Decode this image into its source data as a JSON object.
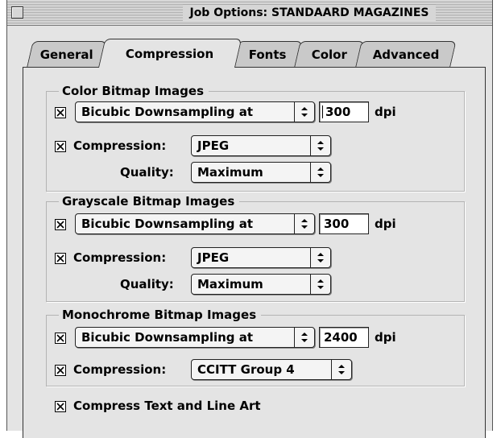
{
  "window": {
    "title": "Job Options: STANDAARD MAGAZINES"
  },
  "tabs": [
    {
      "label": "General",
      "active": false
    },
    {
      "label": "Compression",
      "active": true
    },
    {
      "label": "Fonts",
      "active": false
    },
    {
      "label": "Color",
      "active": false
    },
    {
      "label": "Advanced",
      "active": false
    }
  ],
  "color_group": {
    "title": "Color Bitmap Images",
    "downsample_checked": true,
    "downsample_method": "Bicubic Downsampling at",
    "resolution": "300",
    "unit": "dpi",
    "compression_checked": true,
    "compression_label": "Compression:",
    "compression_value": "JPEG",
    "quality_label": "Quality:",
    "quality_value": "Maximum"
  },
  "gray_group": {
    "title": "Grayscale Bitmap Images",
    "downsample_checked": true,
    "downsample_method": "Bicubic Downsampling at",
    "resolution": "300",
    "unit": "dpi",
    "compression_checked": true,
    "compression_label": "Compression:",
    "compression_value": "JPEG",
    "quality_label": "Quality:",
    "quality_value": "Maximum"
  },
  "mono_group": {
    "title": "Monochrome Bitmap Images",
    "downsample_checked": true,
    "downsample_method": "Bicubic Downsampling at",
    "resolution": "2400",
    "unit": "dpi",
    "compression_checked": true,
    "compression_label": "Compression:",
    "compression_value": "CCITT Group 4"
  },
  "compress_text": {
    "checked": true,
    "label": "Compress Text and Line Art"
  }
}
